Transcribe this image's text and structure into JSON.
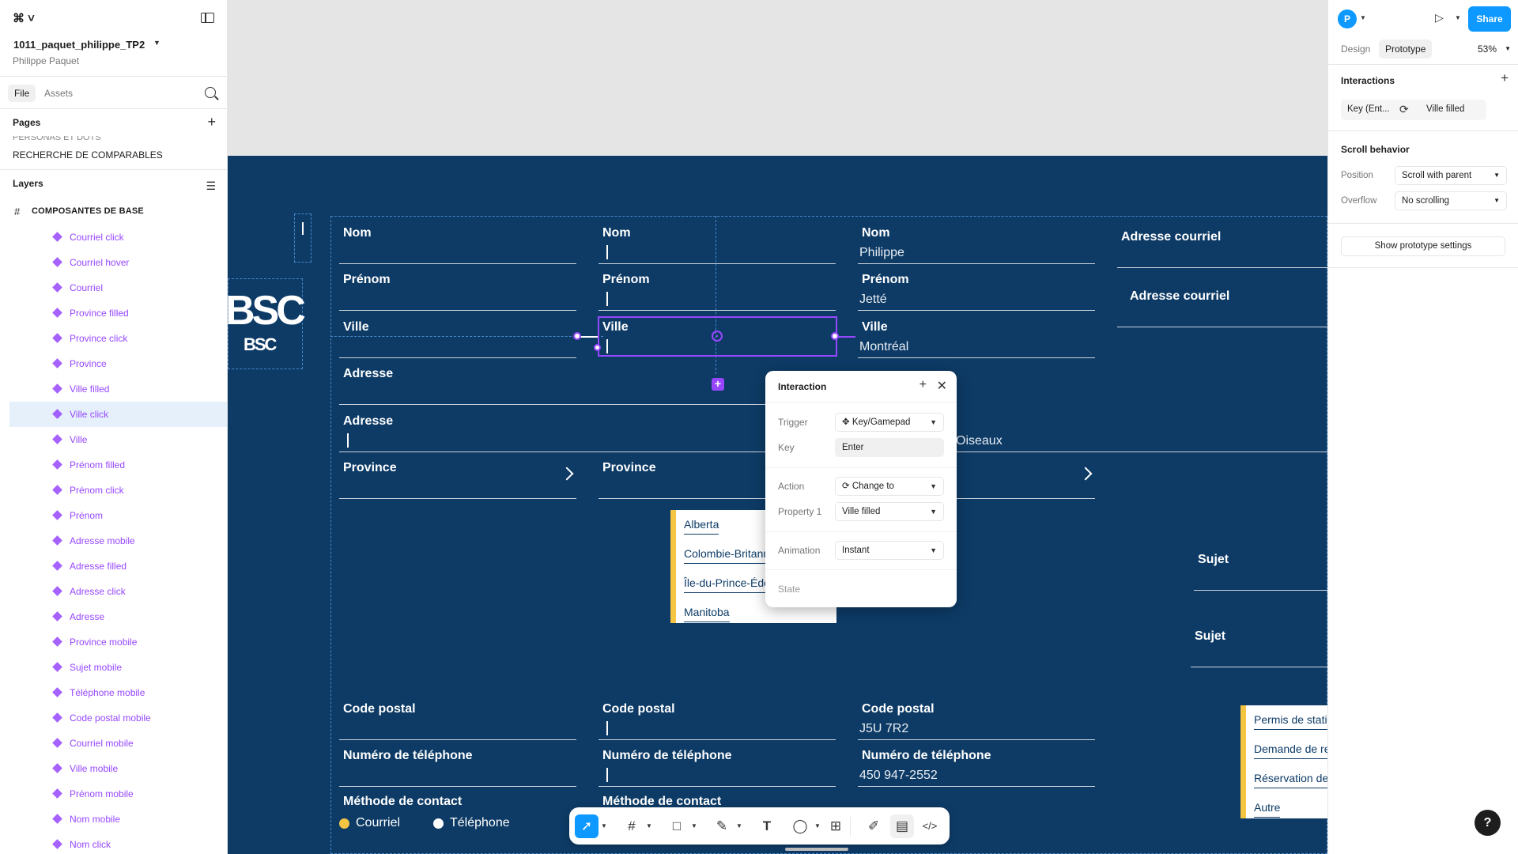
{
  "file": {
    "name": "1011_paquet_philippe_TP2",
    "owner": "Philippe Paquet"
  },
  "left_tabs": [
    "File",
    "Assets"
  ],
  "pages": {
    "title": "Pages",
    "items_cut": "PERSONAS ET DOTS",
    "items": [
      "RECHERCHE DE COMPARABLES"
    ]
  },
  "layers": {
    "title": "Layers",
    "frame": "COMPOSANTES DE BASE",
    "items": [
      "Courriel click",
      "Courriel hover",
      "Courriel",
      "Province filled",
      "Province click",
      "Province",
      "Ville filled",
      "Ville click",
      "Ville",
      "Prénom filled",
      "Prénom click",
      "Prénom",
      "Adresse mobile",
      "Adresse filled",
      "Adresse click",
      "Adresse",
      "Province mobile",
      "Sujet mobile",
      "Téléphone mobile",
      "Code postal mobile",
      "Courriel mobile",
      "Ville mobile",
      "Prénom mobile",
      "Nom mobile",
      "Nom click"
    ],
    "selected_index": 7
  },
  "canvas": {
    "brand": "BSC",
    "col1": {
      "nom": "Nom",
      "prenom": "Prénom",
      "ville": "Ville",
      "adresse1": "Adresse",
      "adresse2": "Adresse",
      "province": "Province"
    },
    "col2": {
      "nom": "Nom",
      "prenom": "Prénom",
      "ville": "Ville",
      "province": "Province"
    },
    "col3": {
      "nom": "Nom",
      "nom_val": "Philippe",
      "prenom": "Prénom",
      "prenom_val": "Jetté",
      "ville": "Ville",
      "ville_val": "Montréal",
      "adresse_val": "Oiseaux"
    },
    "col4": {
      "courriel1": "Adresse courriel",
      "courriel2": "Adresse courriel",
      "sujet1": "Sujet",
      "sujet2": "Sujet"
    },
    "province_dropdown": [
      "Alberta",
      "Colombie-Britannique",
      "Île-du-Prince-Édouard",
      "Manitoba"
    ],
    "sujet_dropdown": [
      "Permis de stationnement",
      "Demande de renseignements",
      "Réservation de salle",
      "Autre"
    ],
    "bottom1": {
      "cp": "Code postal",
      "tel": "Numéro de téléphone",
      "methode": "Méthode de contact",
      "courriel": "Courriel",
      "telephone": "Téléphone"
    },
    "bottom2": {
      "cp": "Code postal",
      "tel": "Numéro de téléphone",
      "methode": "Méthode de contact"
    },
    "bottom3": {
      "cp": "Code postal",
      "cp_val": "J5U 7R2",
      "tel": "Numéro de téléphone",
      "tel_val": "450 947-2552"
    },
    "colors": {
      "frame_bg": "#0d3b66",
      "accent": "#9747ff",
      "dropdown_stripe": "#f4c542",
      "radio_selected": "#f4c542"
    }
  },
  "popup": {
    "title": "Interaction",
    "trigger_label": "Trigger",
    "trigger_value": "Key/Gamepad",
    "key_label": "Key",
    "key_value": "Enter",
    "action_label": "Action",
    "action_value": "Change to",
    "property_label": "Property 1",
    "property_value": "Ville filled",
    "animation_label": "Animation",
    "animation_value": "Instant",
    "state_label": "State"
  },
  "right": {
    "avatar": "P",
    "share": "Share",
    "tabs": [
      "Design",
      "Prototype"
    ],
    "zoom": "53%",
    "interactions_title": "Interactions",
    "interaction_trigger": "Key (Ent...",
    "interaction_target": "Ville filled",
    "scroll_title": "Scroll behavior",
    "position_label": "Position",
    "position_value": "Scroll with parent",
    "overflow_label": "Overflow",
    "overflow_value": "No scrolling",
    "prototype_settings": "Show prototype settings"
  },
  "help": "?"
}
